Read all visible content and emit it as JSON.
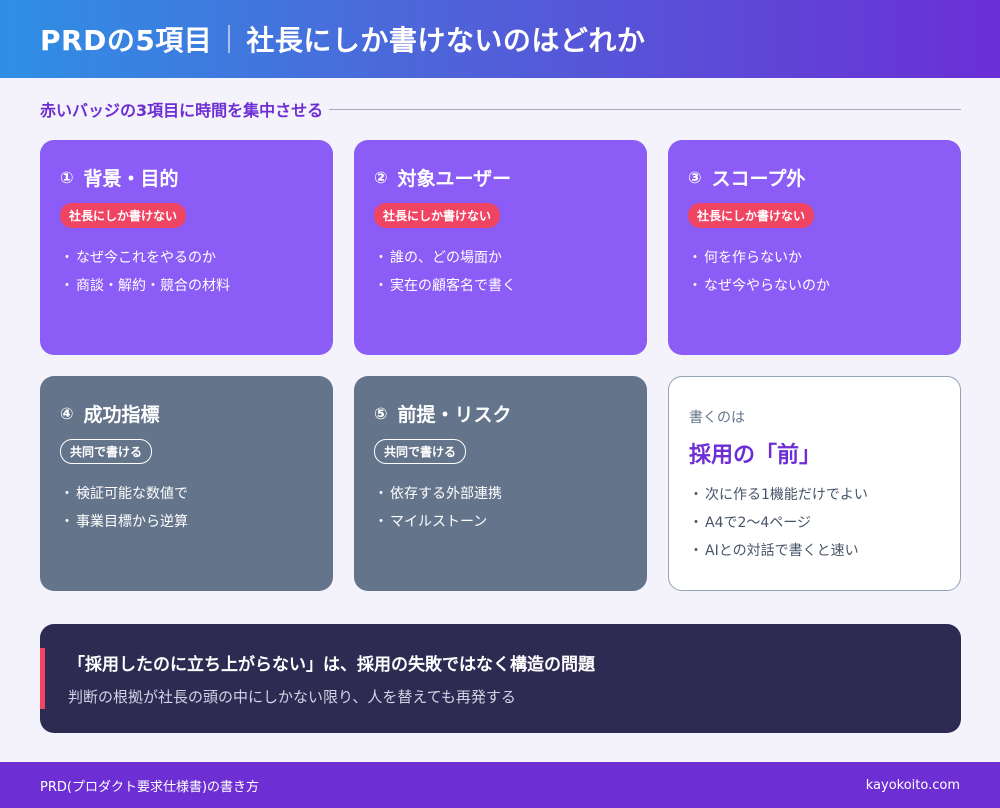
{
  "header": {
    "title_left": "PRDの5項目",
    "title_right": "社長にしか書けないのはどれか"
  },
  "section": {
    "label": "赤いバッジの3項目に時間を集中させる"
  },
  "cards": [
    {
      "num": "①",
      "title": "背景・目的",
      "badge": "社長にしか書けない",
      "bullet_mark": "・",
      "bullets": [
        "なぜ今これをやるのか",
        "商談・解約・競合の材料"
      ]
    },
    {
      "num": "②",
      "title": "対象ユーザー",
      "badge": "社長にしか書けない",
      "bullet_mark": "・",
      "bullets": [
        "誰の、どの場面か",
        "実在の顧客名で書く"
      ]
    },
    {
      "num": "③",
      "title": "スコープ外",
      "badge": "社長にしか書けない",
      "bullet_mark": "・",
      "bullets": [
        "何を作らないか",
        "なぜ今やらないのか"
      ]
    },
    {
      "num": "④",
      "title": "成功指標",
      "badge": "共同で書ける",
      "bullet_mark": "・",
      "bullets": [
        "検証可能な数値で",
        "事業目標から逆算"
      ]
    },
    {
      "num": "⑤",
      "title": "前提・リスク",
      "badge": "共同で書ける",
      "bullet_mark": "・",
      "bullets": [
        "依存する外部連携",
        "マイルストーン"
      ]
    }
  ],
  "summary_card": {
    "sub": "書くのは",
    "main": "採用の「前」",
    "bullet_mark": "・",
    "bullets": [
      "次に作る1機能だけでよい",
      "A4で2〜4ページ",
      "AIとの対話で書くと速い"
    ]
  },
  "callout": {
    "title": "「採用したのに立ち上がらない」は、採用の失敗ではなく構造の問題",
    "text": "判断の根拠が社長の頭の中にしかない限り、人を替えても再発する"
  },
  "footer": {
    "left": "PRD(プロダクト要求仕様書)の書き方",
    "right": "kayokoito.com"
  },
  "colors": {
    "purple_card": "#8b5cf6",
    "slate_card": "#64748b",
    "accent_red": "#ef4462",
    "accent_purple": "#6d2fd4",
    "callout_bg": "#2e2b52"
  }
}
